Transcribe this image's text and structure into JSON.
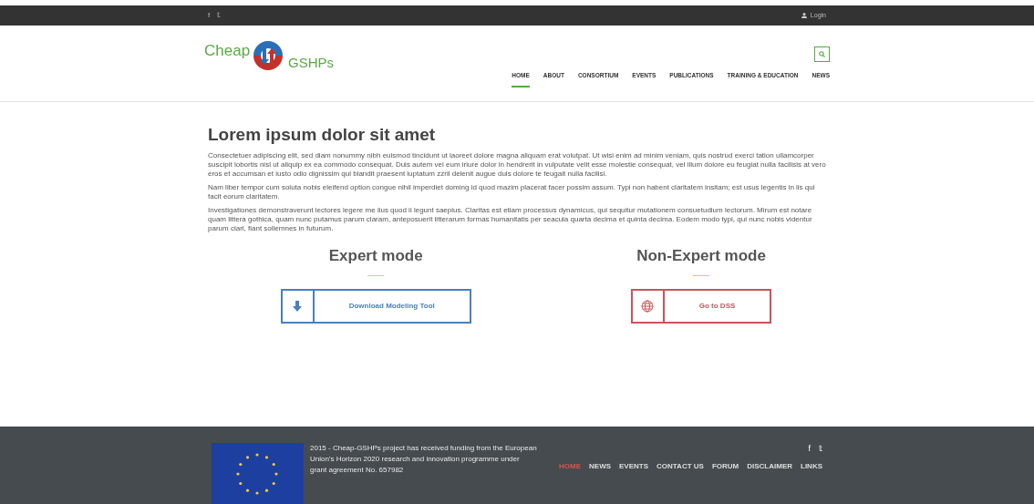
{
  "top_bar": {
    "social": [
      "f",
      "𝕥"
    ],
    "login": "Login"
  },
  "logo": {
    "word_1": "Cheap",
    "word_2": "GSHPs"
  },
  "nav": [
    {
      "label": "HOME",
      "selected": true
    },
    {
      "label": "ABOUT",
      "selected": false
    },
    {
      "label": "CONSORTIUM",
      "selected": false
    },
    {
      "label": "EVENTS",
      "selected": false
    },
    {
      "label": "PUBLICATIONS",
      "selected": false
    },
    {
      "label": "TRAINING & EDUCATION",
      "selected": false
    },
    {
      "label": "NEWS",
      "selected": false
    }
  ],
  "content": {
    "heading": "Lorem ipsum dolor sit amet",
    "paragraphs": [
      "Consectetuer adipiscing elit, sed diam nonummy nibh euismod tincidunt ut laoreet dolore magna aliquam erat volutpat. Ut wisi enim ad minim veniam, quis nostrud exerci tation ullamcorper suscipit lobortis nisl ut aliquip ex ea commodo consequat. Duis autem vel eum iriure dolor in hendrerit in vulputate velit esse molestie consequat, vel illum dolore eu feugiat nulla facilisis at vero eros et accumsan et iusto odio dignissim qui blandit praesent luptatum zzril delenit augue duis dolore te feugait nulla facilisi.",
      "Nam liber tempor cum soluta nobis eleifend option congue nihil imperdiet doming id quod mazim placerat facer possim assum. Typi non habent claritatem insitam; est usus legentis in iis qui facit eorum claritatem.",
      "Investigationes demonstraverunt lectores legere me lius quod ii legunt saepius. Claritas est etiam processus dynamicus, qui sequitur mutationem consuetudium lectorum. Mirum est notare quam littera gothica, quam nunc putamus parum claram, anteposuerit litterarum formas humanitatis per seacula quarta decima et quinta decima. Eodem modo typi, qui nunc nobis videntur parum clari, fiant sollemnes in futurum."
    ]
  },
  "modes": [
    {
      "title": "Expert mode",
      "button": "Download Modeling Tool",
      "kind": "download",
      "color": "#4a7fc0"
    },
    {
      "title": "Non-Expert mode",
      "button": "Go to DSS",
      "kind": "globe",
      "color": "#c9545a"
    }
  ],
  "footer": {
    "funding": "2015 - Cheap-GSHPs project has received funding from the European Union's Horizon 2020 research and innovation programme under grant agreement No. 657982",
    "social": [
      "f",
      "𝕥"
    ],
    "links": [
      {
        "label": "HOME",
        "selected": true
      },
      {
        "label": "NEWS",
        "selected": false
      },
      {
        "label": "EVENTS",
        "selected": false
      },
      {
        "label": "CONTACT US",
        "selected": false
      },
      {
        "label": "FORUM",
        "selected": false
      },
      {
        "label": "DISCLAIMER",
        "selected": false
      },
      {
        "label": "LINKS",
        "selected": false
      }
    ]
  }
}
